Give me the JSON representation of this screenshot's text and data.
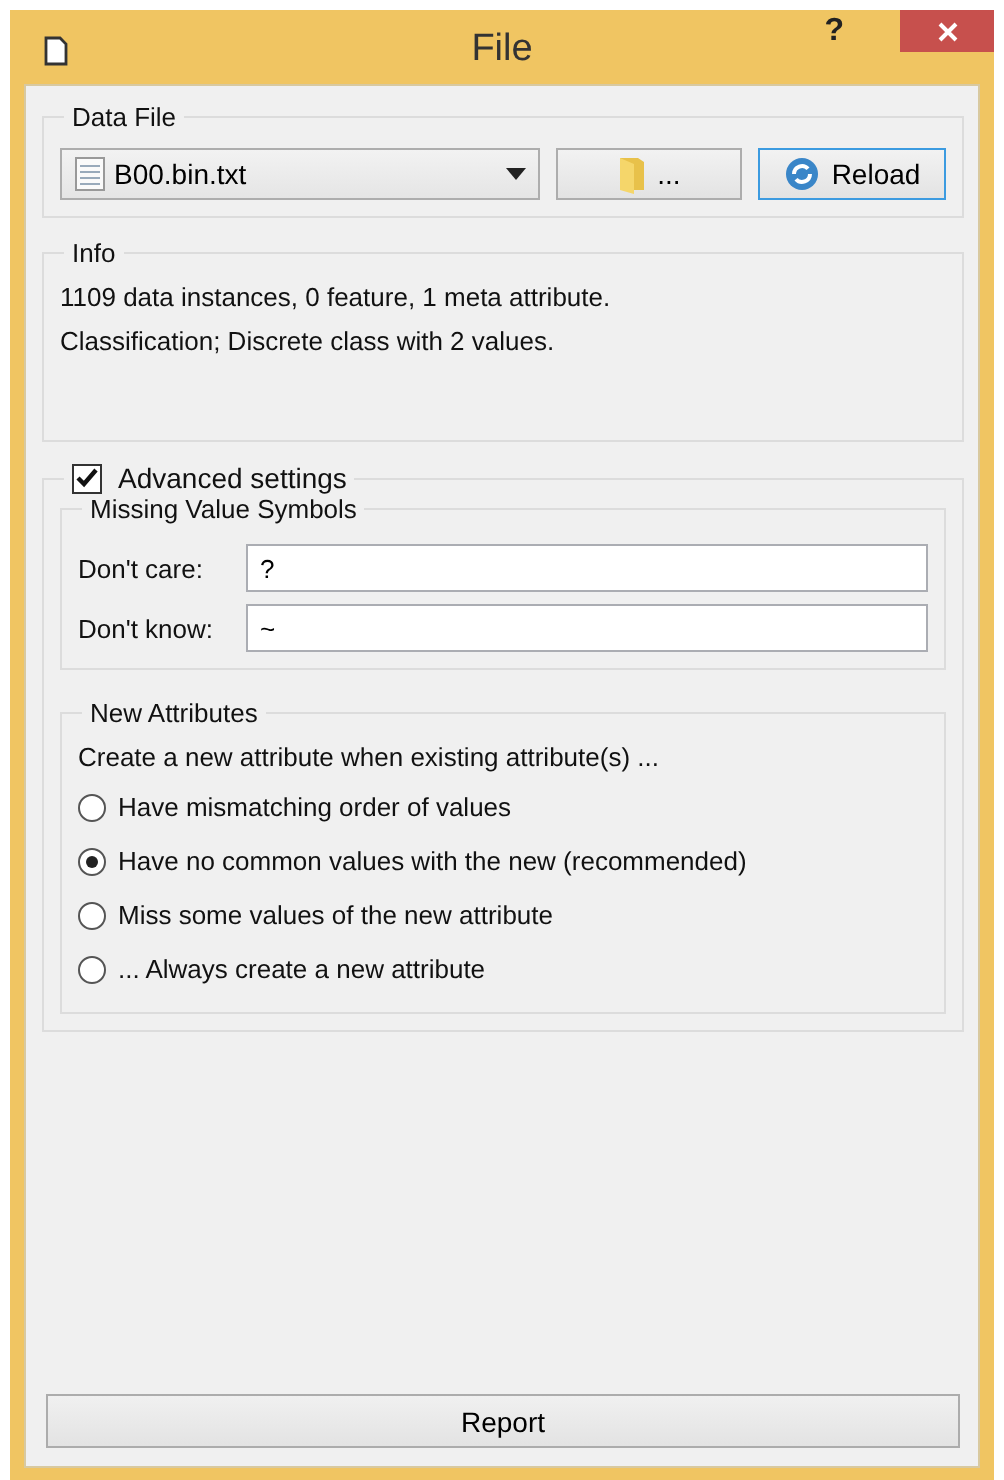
{
  "window": {
    "title": "File",
    "help": "?"
  },
  "data_file": {
    "title": "Data File",
    "file": "B00.bin.txt",
    "browse": "...",
    "reload": "Reload"
  },
  "info": {
    "title": "Info",
    "lines": [
      "1109 data instances, 0 feature, 1 meta attribute.",
      "Classification; Discrete class with 2 values."
    ]
  },
  "advanced": {
    "label": "Advanced settings",
    "checked": true,
    "missing": {
      "title": "Missing Value Symbols",
      "fields": [
        {
          "label": "Don't care:",
          "value": "?"
        },
        {
          "label": "Don't know:",
          "value": "~"
        }
      ]
    },
    "new_attributes": {
      "title": "New Attributes",
      "prompt": "Create a new attribute when existing attribute(s) ...",
      "options": [
        {
          "label": "Have mismatching order of values",
          "selected": false
        },
        {
          "label": "Have no common values with the new (recommended)",
          "selected": true
        },
        {
          "label": "Miss some values of the new attribute",
          "selected": false
        },
        {
          "label": "... Always create a new attribute",
          "selected": false
        }
      ]
    }
  },
  "report": "Report"
}
